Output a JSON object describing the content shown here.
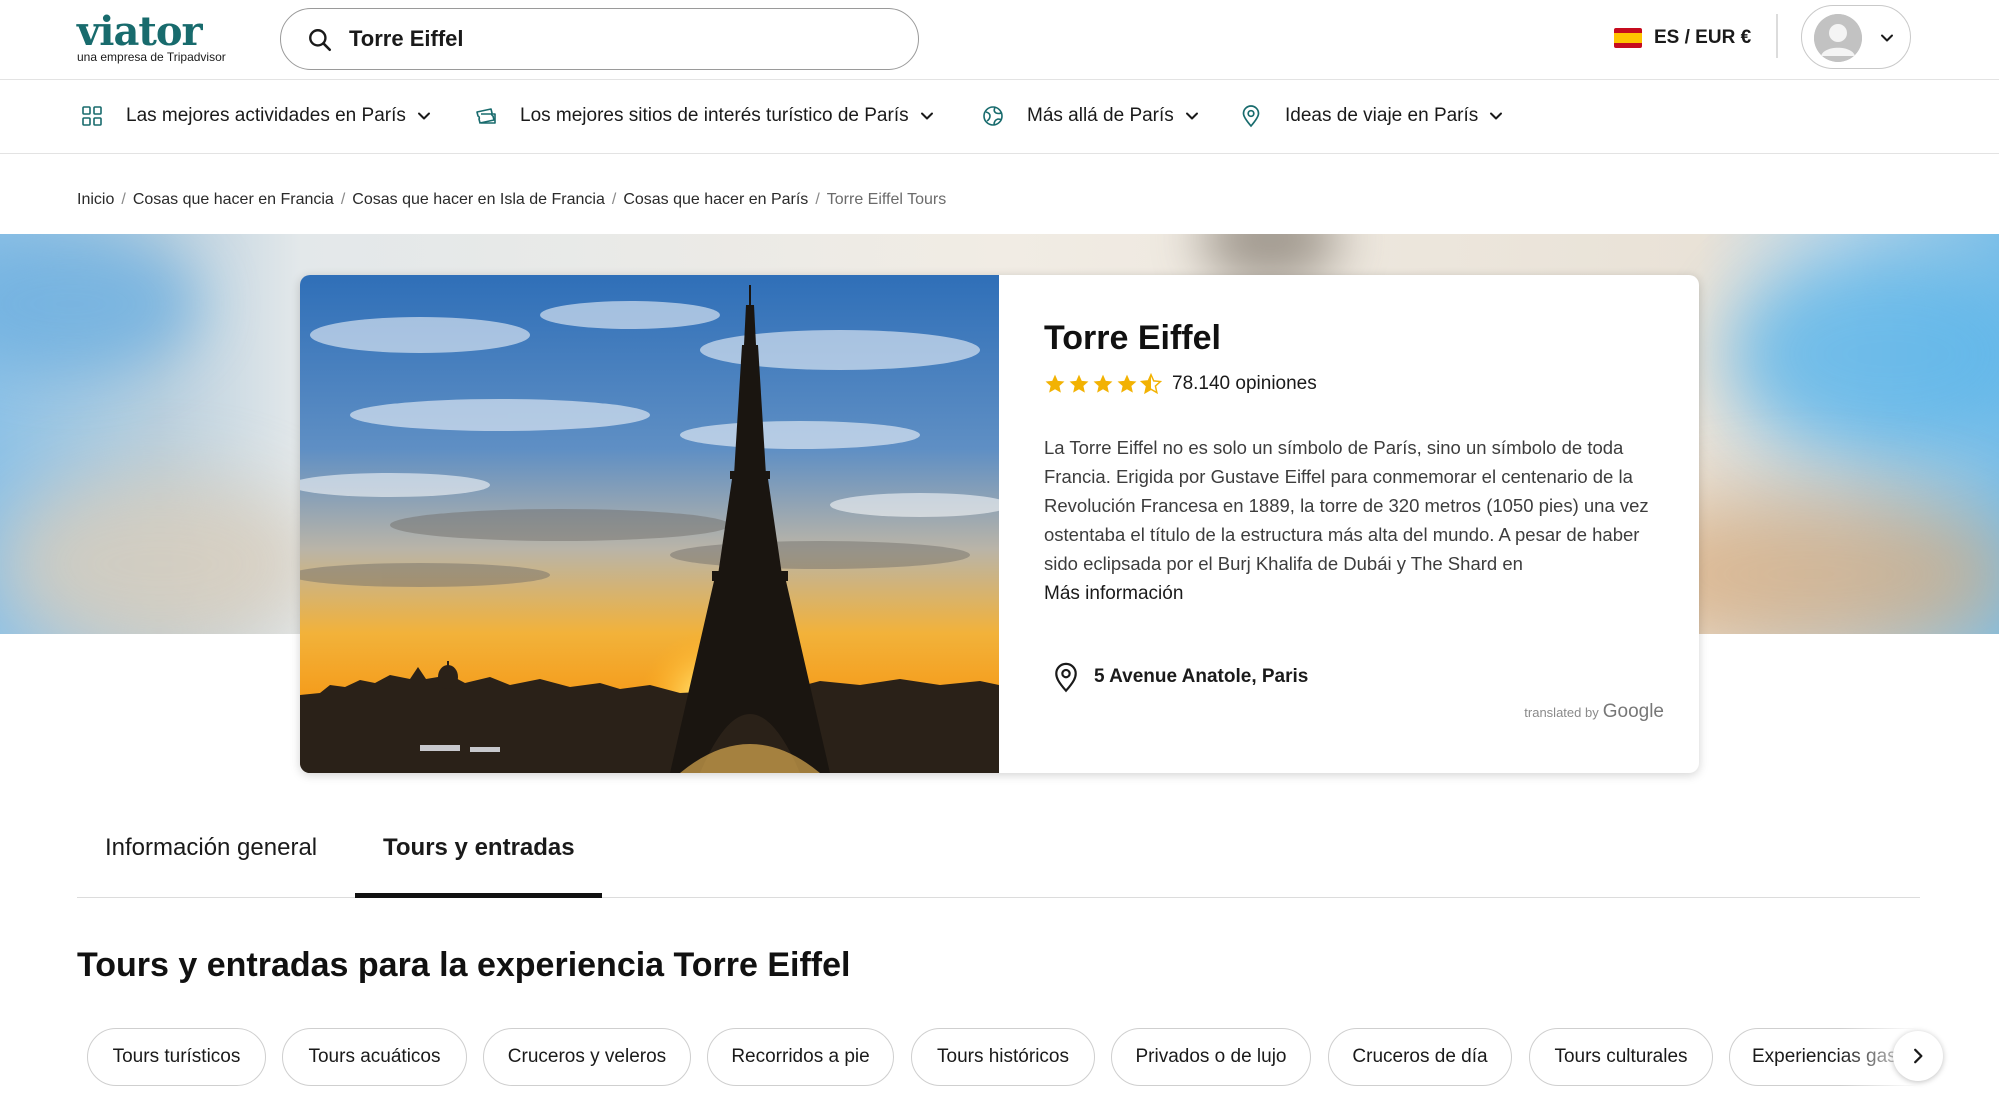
{
  "header": {
    "logo_text": "viator",
    "logo_subtitle": "una empresa de Tripadvisor",
    "search_value": "Torre Eiffel",
    "locale_label": "ES / EUR €",
    "colors": {
      "brand": "#186b6d",
      "flag_red": "#c60b1e",
      "flag_yellow": "#ffc400"
    }
  },
  "catnav": {
    "items": [
      {
        "label": "Las mejores actividades en París",
        "icon": "grid-icon"
      },
      {
        "label": "Los mejores sitios de interés turístico de París",
        "icon": "ticket-icon"
      },
      {
        "label": "Más allá de París",
        "icon": "globe-icon"
      },
      {
        "label": "Ideas de viaje en París",
        "icon": "map-pin-icon"
      }
    ]
  },
  "breadcrumb": {
    "items": [
      "Inicio",
      "Cosas que hacer en Francia",
      "Cosas que hacer en Isla de Francia",
      "Cosas que hacer en París"
    ],
    "current": "Torre Eiffel Tours"
  },
  "hero": {
    "title": "Torre Eiffel",
    "rating": 4.5,
    "reviews": "78.140 opiniones",
    "description": "La Torre Eiffel no es solo un símbolo de París, sino un símbolo de toda Francia. Erigida por Gustave Eiffel para conmemorar el centenario de la Revolución Francesa en 1889, la torre de 320 metros (1050 pies) una vez ostentaba el título de la estructura más alta del mundo. A pesar de haber sido eclipsada por el Burj Khalifa de Dubái y The Shard en",
    "more_link": "Más información",
    "address": "5 Avenue Anatole, Paris",
    "translated_by": "translated by",
    "translated_brand": "Google",
    "colors": {
      "star": "#f2b203"
    }
  },
  "tabs": {
    "items": [
      {
        "label": "Información general",
        "active": false
      },
      {
        "label": "Tours y entradas",
        "active": true
      }
    ]
  },
  "section": {
    "title": "Tours y entradas para la experiencia Torre Eiffel",
    "chips": [
      "Tours turísticos",
      "Tours acuáticos",
      "Cruceros y veleros",
      "Recorridos a pie",
      "Tours históricos",
      "Privados o de lujo",
      "Cruceros de día",
      "Tours culturales",
      "Experiencias gastronómicas"
    ]
  }
}
